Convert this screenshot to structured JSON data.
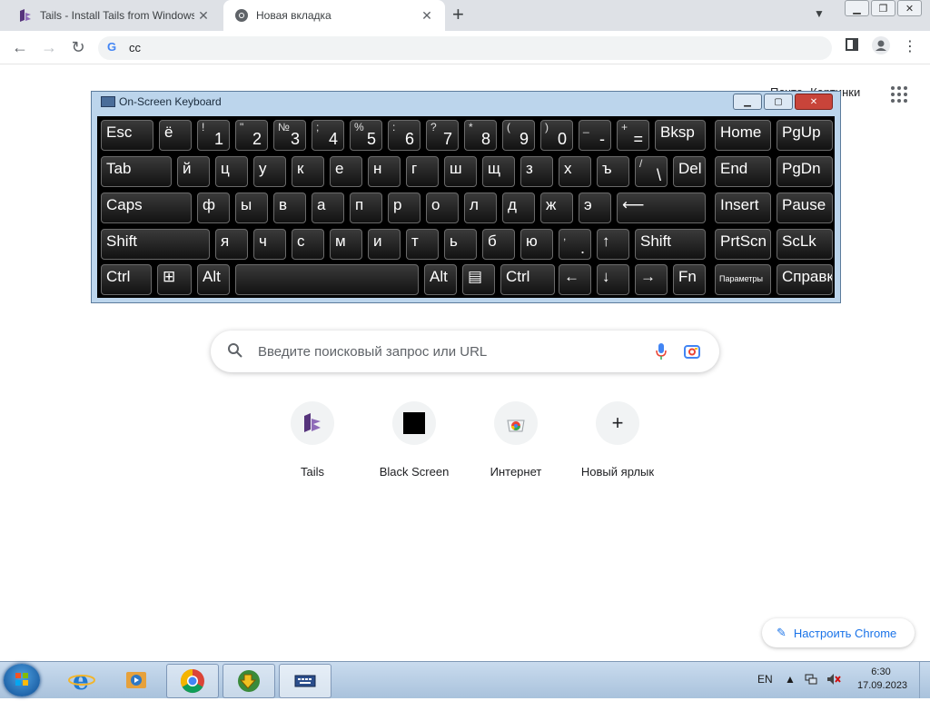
{
  "tabs": [
    {
      "title": "Tails - Install Tails from Windows",
      "active": false
    },
    {
      "title": "Новая вкладка",
      "active": true
    }
  ],
  "omnibox": {
    "value": "сс"
  },
  "top_links": [
    "Почта",
    "Картинки"
  ],
  "search": {
    "placeholder": "Введите поисковый запрос или URL"
  },
  "shortcuts": [
    {
      "label": "Tails",
      "icon": "tails-icon"
    },
    {
      "label": "Black Screen",
      "icon": "black-square-icon"
    },
    {
      "label": "Интернет",
      "icon": "chrome-web-store-icon"
    },
    {
      "label": "Новый ярлык",
      "icon": "plus-icon"
    }
  ],
  "customize": {
    "label": "Настроить Chrome"
  },
  "osk": {
    "title": "On-Screen Keyboard",
    "rows": [
      [
        {
          "m": "Esc"
        },
        {
          "m": "ё"
        },
        {
          "s": "!",
          "p": "1"
        },
        {
          "s": "\"",
          "p": "2"
        },
        {
          "s": "№",
          "p": "3"
        },
        {
          "s": ";",
          "p": "4"
        },
        {
          "s": "%",
          "p": "5"
        },
        {
          "s": ":",
          "p": "6"
        },
        {
          "s": "?",
          "p": "7"
        },
        {
          "s": "*",
          "p": "8"
        },
        {
          "s": "(",
          "p": "9"
        },
        {
          "s": ")",
          "p": "0"
        },
        {
          "s": "_",
          "p": "-"
        },
        {
          "s": "+",
          "p": "="
        },
        {
          "m": "Bksp"
        },
        {
          "m": "Home"
        },
        {
          "m": "PgUp"
        }
      ],
      [
        {
          "m": "Tab"
        },
        {
          "m": "й"
        },
        {
          "m": "ц"
        },
        {
          "m": "у"
        },
        {
          "m": "к"
        },
        {
          "m": "е"
        },
        {
          "m": "н"
        },
        {
          "m": "г"
        },
        {
          "m": "ш"
        },
        {
          "m": "щ"
        },
        {
          "m": "з"
        },
        {
          "m": "х"
        },
        {
          "m": "ъ"
        },
        {
          "s": "/",
          "p": "\\"
        },
        {
          "m": "Del"
        },
        {
          "m": "End"
        },
        {
          "m": "PgDn"
        }
      ],
      [
        {
          "m": "Caps"
        },
        {
          "m": "ф"
        },
        {
          "m": "ы"
        },
        {
          "m": "в"
        },
        {
          "m": "а"
        },
        {
          "m": "п"
        },
        {
          "m": "р"
        },
        {
          "m": "о"
        },
        {
          "m": "л"
        },
        {
          "m": "д"
        },
        {
          "m": "ж"
        },
        {
          "m": "э"
        },
        {
          "m": "⟵"
        },
        {
          "m": "Insert"
        },
        {
          "m": "Pause"
        }
      ],
      [
        {
          "m": "Shift"
        },
        {
          "m": "я"
        },
        {
          "m": "ч"
        },
        {
          "m": "с"
        },
        {
          "m": "м"
        },
        {
          "m": "и"
        },
        {
          "m": "т"
        },
        {
          "m": "ь"
        },
        {
          "m": "б"
        },
        {
          "m": "ю"
        },
        {
          "s": ",",
          "p": "."
        },
        {
          "m": "↑"
        },
        {
          "m": "Shift"
        },
        {
          "m": "PrtScn"
        },
        {
          "m": "ScLk"
        }
      ],
      [
        {
          "m": "Ctrl"
        },
        {
          "icon": "windows-key-icon"
        },
        {
          "m": "Alt"
        },
        {
          "m": ""
        },
        {
          "m": "Alt"
        },
        {
          "icon": "menu-key-icon"
        },
        {
          "m": "Ctrl"
        },
        {
          "m": "←"
        },
        {
          "m": "↓"
        },
        {
          "m": "→"
        },
        {
          "m": "Fn"
        },
        {
          "sm": "Параметры"
        },
        {
          "m": "Справка"
        }
      ]
    ]
  },
  "taskbar": {
    "items": [
      "internet-explorer-icon",
      "media-player-icon",
      "chrome-icon",
      "downloader-icon",
      "on-screen-keyboard-icon"
    ],
    "lang": "EN",
    "time": "6:30",
    "date": "17.09.2023"
  }
}
